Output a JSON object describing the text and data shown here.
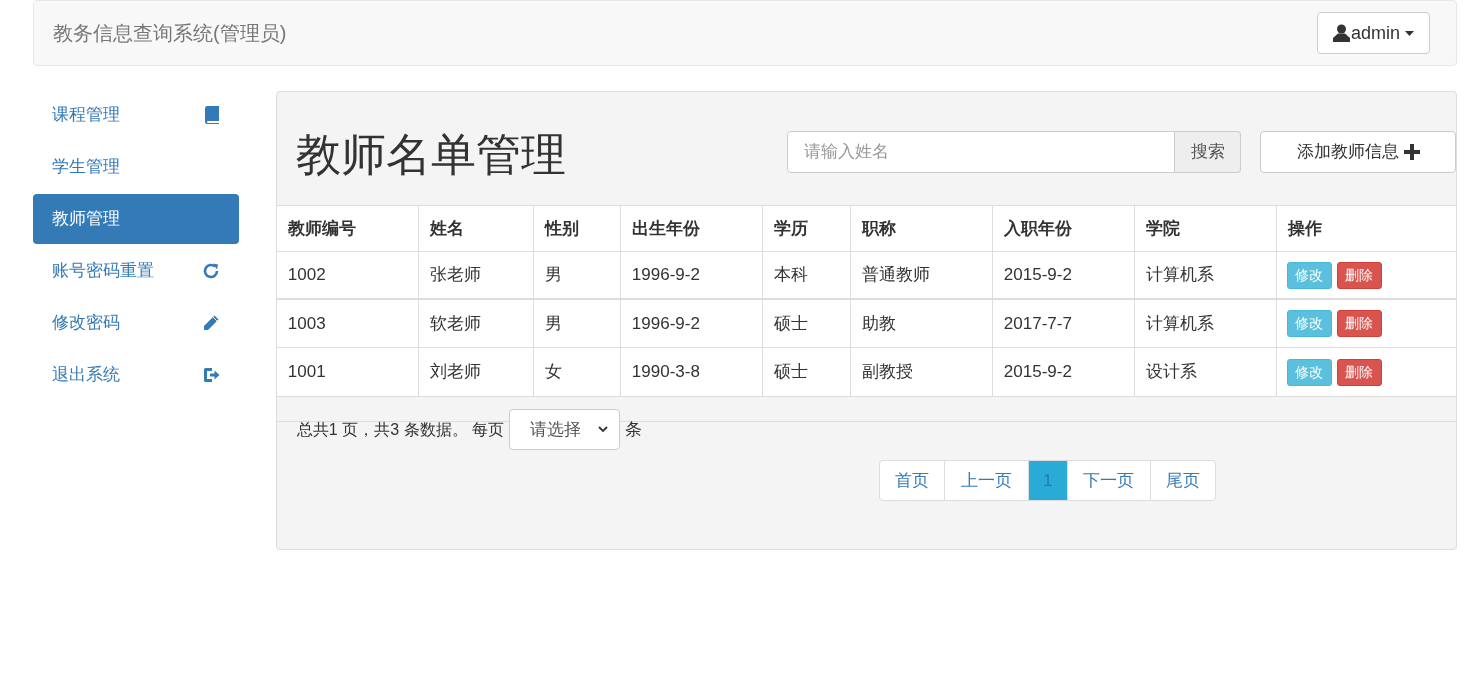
{
  "navbar": {
    "title": "教务信息查询系统(管理员)",
    "user_menu": {
      "label": "admin"
    }
  },
  "sidebar": {
    "items": [
      {
        "label": "课程管理",
        "selected": false
      },
      {
        "label": "学生管理",
        "selected": false
      },
      {
        "label": "教师管理",
        "selected": true
      },
      {
        "label": "账号密码重置",
        "selected": false
      },
      {
        "label": "修改密码",
        "selected": false
      },
      {
        "label": "退出系统",
        "selected": false
      }
    ]
  },
  "main": {
    "heading": "教师名单管理",
    "search": {
      "placeholder": "请输入姓名",
      "button": "搜索"
    },
    "add_button": "添加教师信息",
    "table": {
      "columns": [
        "教师编号",
        "姓名",
        "性别",
        "出生年份",
        "学历",
        "职称",
        "入职年份",
        "学院",
        "操作"
      ],
      "rows": [
        {
          "cells": [
            "1002",
            "张老师",
            "男",
            "1996-9-2",
            "本科",
            "普通教师",
            "2015-9-2",
            "计算机系"
          ],
          "actions": [
            {
              "label": "修改",
              "kind": "edit"
            },
            {
              "label": "删除",
              "kind": "delete"
            }
          ]
        },
        {
          "cells": [
            "1003",
            "软老师",
            "男",
            "1996-9-2",
            "硕士",
            "助教",
            "2017-7-7",
            "计算机系"
          ],
          "actions": [
            {
              "label": "修改",
              "kind": "edit"
            },
            {
              "label": "删除",
              "kind": "delete"
            }
          ]
        },
        {
          "cells": [
            "1001",
            "刘老师",
            "女",
            "1990-3-8",
            "硕士",
            "副教授",
            "2015-9-2",
            "设计系"
          ],
          "actions": [
            {
              "label": "修改",
              "kind": "edit"
            },
            {
              "label": "删除",
              "kind": "delete"
            }
          ]
        }
      ]
    },
    "pagination": {
      "summary": "总共1 页，共3 条数据。 每页",
      "per_page_select": {
        "value": "请选择"
      },
      "unit": "条",
      "pages": [
        {
          "label": "首页",
          "selected": false
        },
        {
          "label": "上一页",
          "selected": false
        },
        {
          "label": "1",
          "selected": true
        },
        {
          "label": "下一页",
          "selected": false
        },
        {
          "label": "尾页",
          "selected": false
        }
      ]
    }
  }
}
